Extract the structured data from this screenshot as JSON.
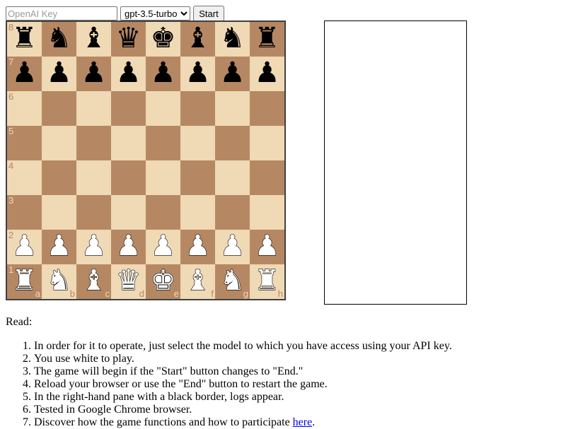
{
  "controls": {
    "api_key_placeholder": "OpenAI Key",
    "model_options": [
      "gpt-3.5-turbo"
    ],
    "model_selected": "gpt-3.5-turbo",
    "start_label": "Start"
  },
  "board": {
    "light_color": "#f0d9b5",
    "dark_color": "#b58863",
    "border_color": "#404040",
    "files": [
      "a",
      "b",
      "c",
      "d",
      "e",
      "f",
      "g",
      "h"
    ],
    "ranks": [
      "8",
      "7",
      "6",
      "5",
      "4",
      "3",
      "2",
      "1"
    ],
    "position": [
      [
        "br",
        "bn",
        "bb",
        "bq",
        "bk",
        "bb",
        "bn",
        "br"
      ],
      [
        "bp",
        "bp",
        "bp",
        "bp",
        "bp",
        "bp",
        "bp",
        "bp"
      ],
      [
        "",
        "",
        "",
        "",
        "",
        "",
        "",
        ""
      ],
      [
        "",
        "",
        "",
        "",
        "",
        "",
        "",
        ""
      ],
      [
        "",
        "",
        "",
        "",
        "",
        "",
        "",
        ""
      ],
      [
        "",
        "",
        "",
        "",
        "",
        "",
        "",
        ""
      ],
      [
        "wp",
        "wp",
        "wp",
        "wp",
        "wp",
        "wp",
        "wp",
        "wp"
      ],
      [
        "wr",
        "wn",
        "wb",
        "wq",
        "wk",
        "wb",
        "wn",
        "wr"
      ]
    ]
  },
  "log_pane": {
    "lines": []
  },
  "instructions": {
    "heading": "Read:",
    "items": [
      "In order for it to operate, just select the model to which you have access using your API key.",
      "You use white to play.",
      "The game will begin if the \"Start\" button changes to \"End.\"",
      "Reload your browser or use the \"End\" button to restart the game.",
      "In the right-hand pane with a black border, logs appear.",
      "Tested in Google Chrome browser."
    ],
    "last_item_text": "Discover how the game functions and how to participate ",
    "last_item_link": "here",
    "last_item_suffix": "."
  }
}
